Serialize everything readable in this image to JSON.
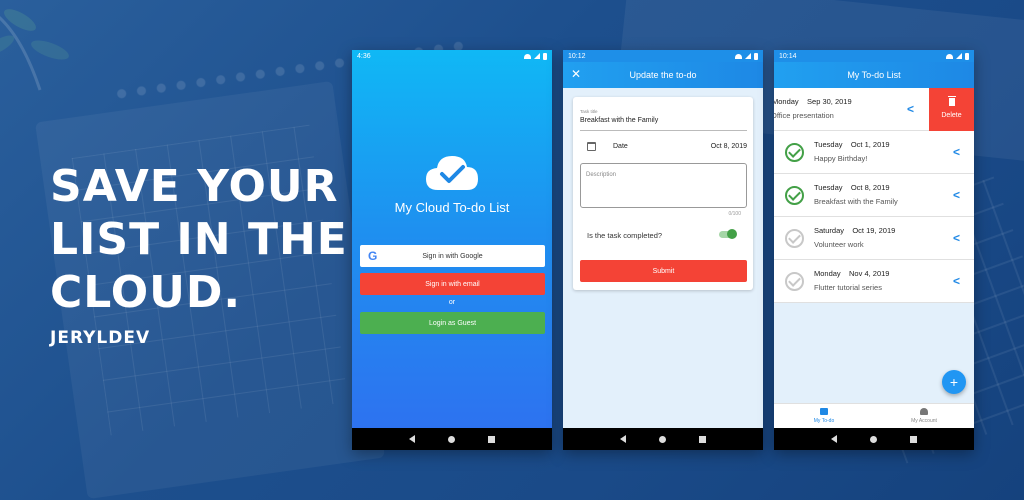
{
  "headline": [
    "SAVE YOUR",
    "LIST IN THE",
    "CLOUD."
  ],
  "brand": "JERYLDEV",
  "phone1": {
    "time": "4:36",
    "app_title": "My Cloud To-do List",
    "google_button": "Sign in with Google",
    "email_button": "Sign in with email",
    "or": "or",
    "guest_button": "Login as Guest"
  },
  "phone2": {
    "time": "10:12",
    "title": "Update the to-do",
    "task_title_label": "Task title",
    "task_title_value": "Breakfast with the Family",
    "date_label": "Date",
    "date_value": "Oct 8, 2019",
    "description_placeholder": "Description",
    "counter": "0/100",
    "completed_question": "Is the task completed?",
    "submit": "Submit"
  },
  "phone3": {
    "time": "10:14",
    "title": "My To-do List",
    "todos": [
      {
        "date": "Monday    Sep 30, 2019",
        "title": "Office presentation",
        "completed": false
      },
      {
        "date": "Tuesday    Oct 1, 2019",
        "title": "Happy Birthday!",
        "completed": true
      },
      {
        "date": "Tuesday    Oct 8, 2019",
        "title": "Breakfast with the Family",
        "completed": true
      },
      {
        "date": "Saturday    Oct 19, 2019",
        "title": "Volunteer work",
        "completed": false
      },
      {
        "date": "Monday    Nov 4, 2019",
        "title": "Flutter tutorial series",
        "completed": false
      }
    ],
    "delete_label": "Delete",
    "fab": "+",
    "nav": {
      "todo": "My To-do",
      "account": "My Account"
    }
  },
  "colors": {
    "primary": "#1e88e5",
    "danger": "#f44336",
    "success": "#4caf50",
    "background": "#1c4f8f"
  }
}
